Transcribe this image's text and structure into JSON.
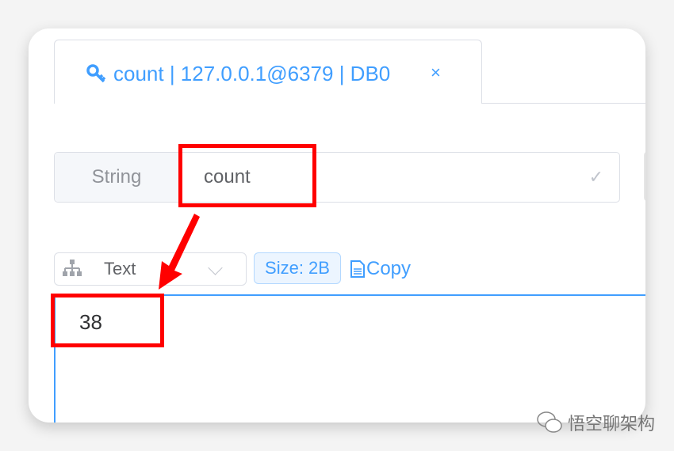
{
  "tab": {
    "title": "count | 127.0.0.1@6379 | DB0",
    "icon": "key-icon",
    "close": "×"
  },
  "key": {
    "type": "String",
    "name": "count",
    "confirm_icon": "check-icon"
  },
  "toolbar": {
    "format": "Text",
    "format_icon": "sitemap-icon",
    "size": "Size: 2B",
    "copy": "Copy",
    "copy_icon": "document-icon"
  },
  "editor": {
    "value": "38"
  },
  "watermark": {
    "text": "悟空聊架构",
    "icon": "wechat-icon"
  },
  "colors": {
    "accent": "#409eff",
    "highlight": "#ff0000"
  }
}
